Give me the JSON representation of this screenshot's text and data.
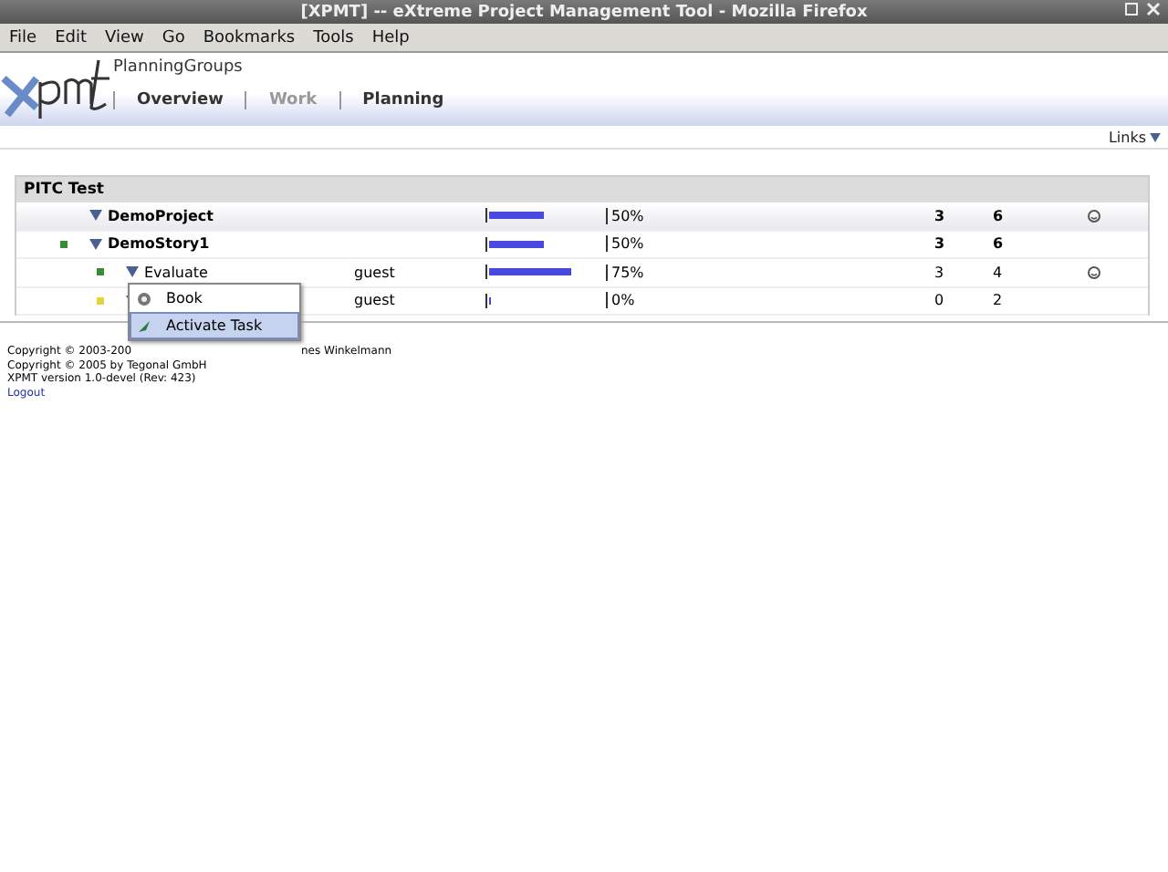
{
  "window": {
    "title": "[XPMT] -- eXtreme Project Management Tool - Mozilla Firefox"
  },
  "menu_bar": [
    "File",
    "Edit",
    "View",
    "Go",
    "Bookmarks",
    "Tools",
    "Help"
  ],
  "header": {
    "group": "PlanningGroups",
    "tabs": [
      {
        "label": "Overview",
        "selected": false,
        "disabled": false
      },
      {
        "label": "Work",
        "selected": false,
        "disabled": true
      },
      {
        "label": "Planning",
        "selected": false,
        "disabled": false
      }
    ],
    "links": "Links"
  },
  "section": {
    "title": "PITC Test",
    "rows": [
      {
        "kind": "project",
        "name": "DemoProject",
        "user": "",
        "level": 0.5,
        "percent": "50%",
        "column_1": "3",
        "column_2": "6",
        "smiley": true
      },
      {
        "kind": "story",
        "name": "DemoStory1",
        "user": "",
        "level": 0.5,
        "percent": "50%",
        "column_1": "3",
        "column_2": "6",
        "smiley": false,
        "color": "#3a8a3a"
      },
      {
        "kind": "task",
        "name": "Evaluate",
        "user": "guest",
        "level": 0.75,
        "percent": "75%",
        "column_1": "3",
        "column_2": "4",
        "smiley": true,
        "color": "#3a8a3a"
      },
      {
        "kind": "task",
        "name": "",
        "user": "guest",
        "level": 0,
        "percent": "0%",
        "column_1": "0",
        "column_2": "2",
        "smiley": false,
        "color": "#e8d040"
      }
    ]
  },
  "context_menu": [
    {
      "label": "Book",
      "selected": false
    },
    {
      "label": "Activate Task",
      "selected": true
    }
  ],
  "footer": {
    "lines": [
      [
        "Copyright © 2003-200",
        "nes Winkelmann"
      ],
      [
        "Copyright © 2005 by Tegonal GmbH"
      ],
      [
        "XPMT version 1.0-devel (Rev: 423)"
      ]
    ],
    "logout": "Logout"
  }
}
